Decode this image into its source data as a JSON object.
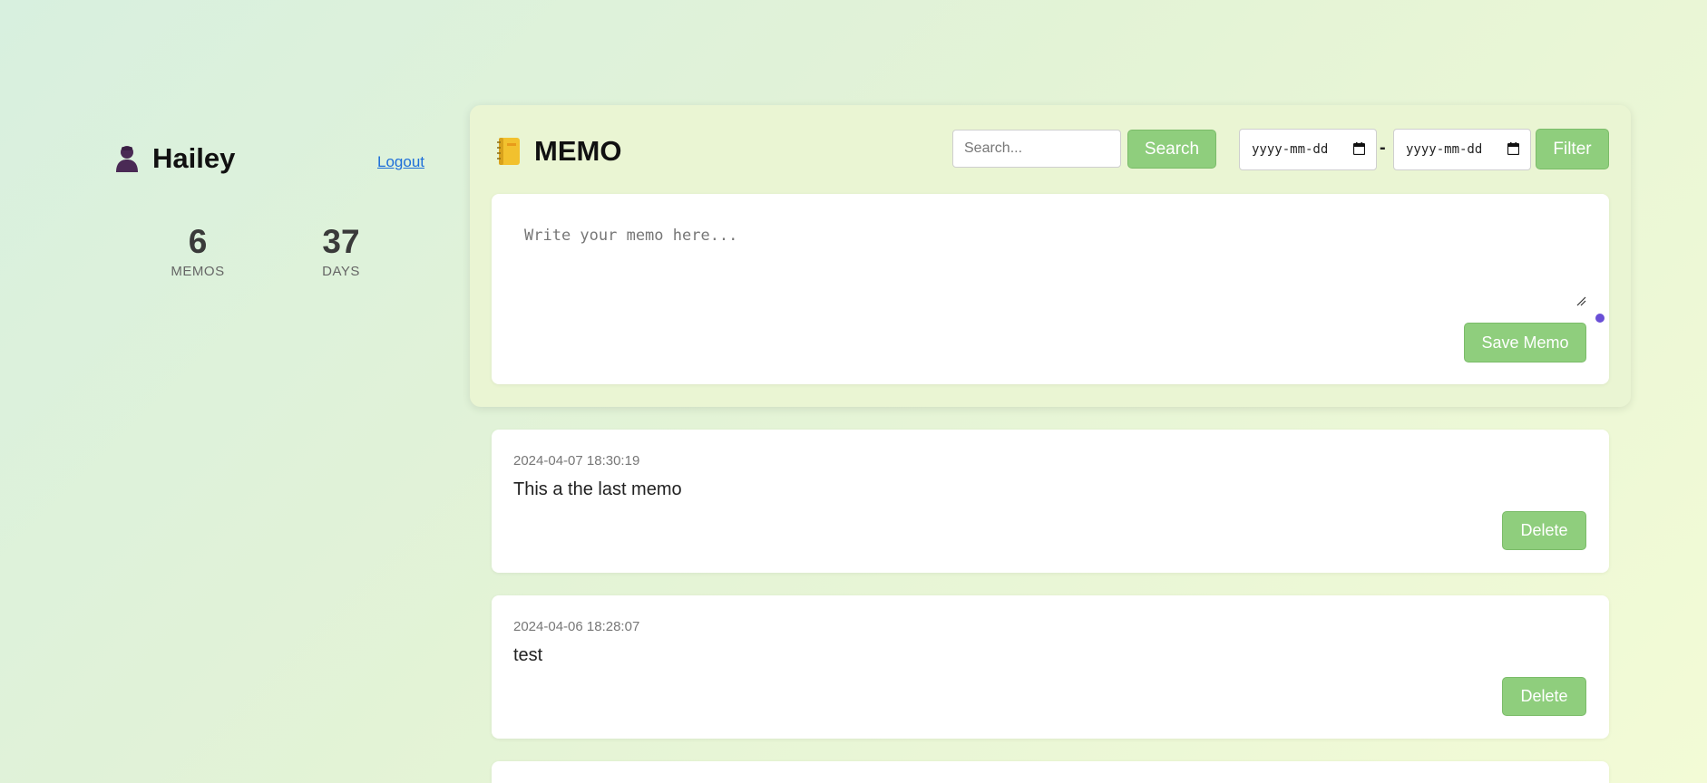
{
  "user": {
    "name": "Hailey",
    "logout_label": "Logout"
  },
  "stats": [
    {
      "value": "6",
      "label": "MEMOS"
    },
    {
      "value": "37",
      "label": "DAYS"
    }
  ],
  "header": {
    "title": "MEMO",
    "search_placeholder": "Search...",
    "search_label": "Search",
    "date_from": "yyyy-mm-dd",
    "date_separator": "-",
    "date_to": "yyyy-mm-dd",
    "filter_label": "Filter"
  },
  "compose": {
    "placeholder": "Write your memo here...",
    "save_label": "Save Memo"
  },
  "memos": [
    {
      "date": "2024-04-07 18:30:19",
      "text": "This a the last memo",
      "delete_label": "Delete"
    },
    {
      "date": "2024-04-06 18:28:07",
      "text": "test",
      "delete_label": "Delete"
    }
  ],
  "colors": {
    "accent": "#8fce7d",
    "link": "#1e6fd9",
    "indicator": "#6a4fd6"
  },
  "icons": {
    "avatar": "person-icon",
    "title": "notebook-icon",
    "date": "calendar-icon"
  }
}
